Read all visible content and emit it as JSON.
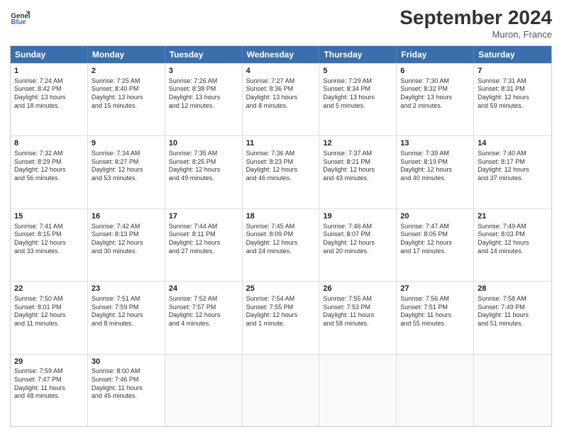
{
  "header": {
    "logo_line1": "General",
    "logo_line2": "Blue",
    "month": "September 2024",
    "location": "Muron, France"
  },
  "days_of_week": [
    "Sunday",
    "Monday",
    "Tuesday",
    "Wednesday",
    "Thursday",
    "Friday",
    "Saturday"
  ],
  "weeks": [
    [
      {
        "day": "1",
        "lines": [
          "Sunrise: 7:24 AM",
          "Sunset: 8:42 PM",
          "Daylight: 13 hours",
          "and 18 minutes."
        ]
      },
      {
        "day": "2",
        "lines": [
          "Sunrise: 7:25 AM",
          "Sunset: 8:40 PM",
          "Daylight: 13 hours",
          "and 15 minutes."
        ]
      },
      {
        "day": "3",
        "lines": [
          "Sunrise: 7:26 AM",
          "Sunset: 8:38 PM",
          "Daylight: 13 hours",
          "and 12 minutes."
        ]
      },
      {
        "day": "4",
        "lines": [
          "Sunrise: 7:27 AM",
          "Sunset: 8:36 PM",
          "Daylight: 13 hours",
          "and 8 minutes."
        ]
      },
      {
        "day": "5",
        "lines": [
          "Sunrise: 7:29 AM",
          "Sunset: 8:34 PM",
          "Daylight: 13 hours",
          "and 5 minutes."
        ]
      },
      {
        "day": "6",
        "lines": [
          "Sunrise: 7:30 AM",
          "Sunset: 8:32 PM",
          "Daylight: 13 hours",
          "and 2 minutes."
        ]
      },
      {
        "day": "7",
        "lines": [
          "Sunrise: 7:31 AM",
          "Sunset: 8:31 PM",
          "Daylight: 12 hours",
          "and 59 minutes."
        ]
      }
    ],
    [
      {
        "day": "8",
        "lines": [
          "Sunrise: 7:32 AM",
          "Sunset: 8:29 PM",
          "Daylight: 12 hours",
          "and 56 minutes."
        ]
      },
      {
        "day": "9",
        "lines": [
          "Sunrise: 7:34 AM",
          "Sunset: 8:27 PM",
          "Daylight: 12 hours",
          "and 53 minutes."
        ]
      },
      {
        "day": "10",
        "lines": [
          "Sunrise: 7:35 AM",
          "Sunset: 8:25 PM",
          "Daylight: 12 hours",
          "and 49 minutes."
        ]
      },
      {
        "day": "11",
        "lines": [
          "Sunrise: 7:36 AM",
          "Sunset: 8:23 PM",
          "Daylight: 12 hours",
          "and 46 minutes."
        ]
      },
      {
        "day": "12",
        "lines": [
          "Sunrise: 7:37 AM",
          "Sunset: 8:21 PM",
          "Daylight: 12 hours",
          "and 43 minutes."
        ]
      },
      {
        "day": "13",
        "lines": [
          "Sunrise: 7:39 AM",
          "Sunset: 8:19 PM",
          "Daylight: 12 hours",
          "and 40 minutes."
        ]
      },
      {
        "day": "14",
        "lines": [
          "Sunrise: 7:40 AM",
          "Sunset: 8:17 PM",
          "Daylight: 12 hours",
          "and 37 minutes."
        ]
      }
    ],
    [
      {
        "day": "15",
        "lines": [
          "Sunrise: 7:41 AM",
          "Sunset: 8:15 PM",
          "Daylight: 12 hours",
          "and 33 minutes."
        ]
      },
      {
        "day": "16",
        "lines": [
          "Sunrise: 7:42 AM",
          "Sunset: 8:13 PM",
          "Daylight: 12 hours",
          "and 30 minutes."
        ]
      },
      {
        "day": "17",
        "lines": [
          "Sunrise: 7:44 AM",
          "Sunset: 8:11 PM",
          "Daylight: 12 hours",
          "and 27 minutes."
        ]
      },
      {
        "day": "18",
        "lines": [
          "Sunrise: 7:45 AM",
          "Sunset: 8:09 PM",
          "Daylight: 12 hours",
          "and 24 minutes."
        ]
      },
      {
        "day": "19",
        "lines": [
          "Sunrise: 7:46 AM",
          "Sunset: 8:07 PM",
          "Daylight: 12 hours",
          "and 20 minutes."
        ]
      },
      {
        "day": "20",
        "lines": [
          "Sunrise: 7:47 AM",
          "Sunset: 8:05 PM",
          "Daylight: 12 hours",
          "and 17 minutes."
        ]
      },
      {
        "day": "21",
        "lines": [
          "Sunrise: 7:49 AM",
          "Sunset: 8:03 PM",
          "Daylight: 12 hours",
          "and 14 minutes."
        ]
      }
    ],
    [
      {
        "day": "22",
        "lines": [
          "Sunrise: 7:50 AM",
          "Sunset: 8:01 PM",
          "Daylight: 12 hours",
          "and 11 minutes."
        ]
      },
      {
        "day": "23",
        "lines": [
          "Sunrise: 7:51 AM",
          "Sunset: 7:59 PM",
          "Daylight: 12 hours",
          "and 8 minutes."
        ]
      },
      {
        "day": "24",
        "lines": [
          "Sunrise: 7:52 AM",
          "Sunset: 7:57 PM",
          "Daylight: 12 hours",
          "and 4 minutes."
        ]
      },
      {
        "day": "25",
        "lines": [
          "Sunrise: 7:54 AM",
          "Sunset: 7:55 PM",
          "Daylight: 12 hours",
          "and 1 minute."
        ]
      },
      {
        "day": "26",
        "lines": [
          "Sunrise: 7:55 AM",
          "Sunset: 7:53 PM",
          "Daylight: 11 hours",
          "and 58 minutes."
        ]
      },
      {
        "day": "27",
        "lines": [
          "Sunrise: 7:56 AM",
          "Sunset: 7:51 PM",
          "Daylight: 11 hours",
          "and 55 minutes."
        ]
      },
      {
        "day": "28",
        "lines": [
          "Sunrise: 7:58 AM",
          "Sunset: 7:49 PM",
          "Daylight: 11 hours",
          "and 51 minutes."
        ]
      }
    ],
    [
      {
        "day": "29",
        "lines": [
          "Sunrise: 7:59 AM",
          "Sunset: 7:47 PM",
          "Daylight: 11 hours",
          "and 48 minutes."
        ]
      },
      {
        "day": "30",
        "lines": [
          "Sunrise: 8:00 AM",
          "Sunset: 7:46 PM",
          "Daylight: 11 hours",
          "and 45 minutes."
        ]
      },
      {
        "day": "",
        "lines": []
      },
      {
        "day": "",
        "lines": []
      },
      {
        "day": "",
        "lines": []
      },
      {
        "day": "",
        "lines": []
      },
      {
        "day": "",
        "lines": []
      }
    ]
  ]
}
